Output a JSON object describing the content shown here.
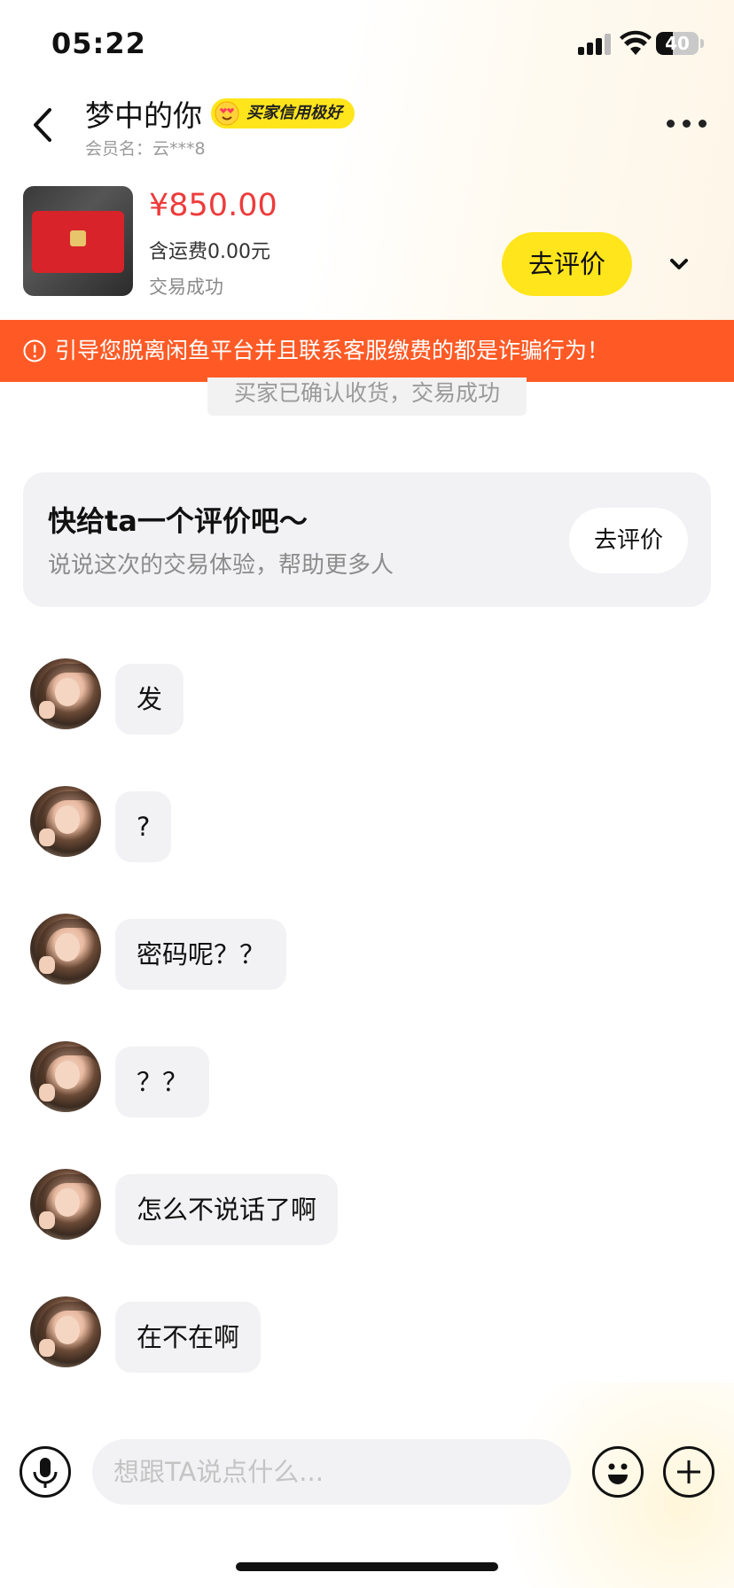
{
  "status_bar": {
    "time": "05:22",
    "battery": "40",
    "battery_level": 0.4
  },
  "header": {
    "name": "梦中的你",
    "badge": "买家信用极好",
    "member": "会员名：云***8"
  },
  "product": {
    "price": "¥850.00",
    "shipping": "含运费0.00元",
    "status": "交易成功",
    "rate_button": "去评价"
  },
  "warning": {
    "text": "引导您脱离闲鱼平台并且联系客服缴费的都是诈骗行为！"
  },
  "system_message": "买家已确认收货，交易成功",
  "review_card": {
    "title": "快给ta一个评价吧～",
    "subtitle": "说说这次的交易体验，帮助更多人",
    "button": "去评价"
  },
  "messages": [
    {
      "text": "发"
    },
    {
      "text": "?"
    },
    {
      "text": "密码呢？？"
    },
    {
      "text": "？？"
    },
    {
      "text": "怎么不说话了啊"
    },
    {
      "text": "在不在啊"
    }
  ],
  "input": {
    "placeholder": "想跟TA说点什么..."
  },
  "colors": {
    "accent_yellow": "#ffe51c",
    "price_red": "#ee3b3b",
    "warning_orange": "#ff5a26"
  }
}
